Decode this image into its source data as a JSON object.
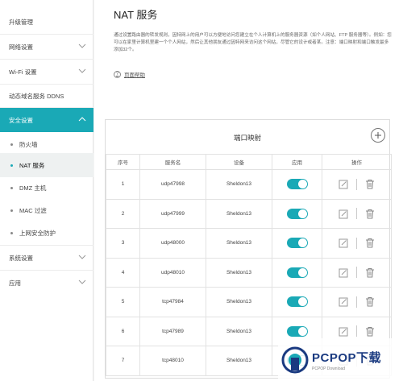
{
  "sidebar": {
    "items": [
      {
        "label": "升级管理"
      },
      {
        "label": "网络设置"
      },
      {
        "label": "Wi-Fi 设置"
      },
      {
        "label": "动态域名服务 DDNS"
      },
      {
        "label": "安全设置"
      },
      {
        "label": "防火墙"
      },
      {
        "label": "NAT 服务"
      },
      {
        "label": "DMZ 主机"
      },
      {
        "label": "MAC 过滤"
      },
      {
        "label": "上网安全防护"
      },
      {
        "label": "系统设置"
      },
      {
        "label": "应用"
      }
    ]
  },
  "main": {
    "title": "NAT 服务",
    "description": "通过设置路由器的转发规则，因特网上的用户可以方便地访问您建立在个人计算机上的服务器资源（如个人网站、FTP 服务器等）。例如：您可以在家里计算机里建一个个人网站，然后让其他朋友通过因特网来访问这个网站，尽管它的设计或者某。注意：端口映射和端口触发最多添加32个。",
    "help_label": "页面帮助",
    "panel": {
      "title": "端口映射",
      "columns": [
        "序号",
        "服务名",
        "设备",
        "应用",
        "操作"
      ],
      "rows": [
        {
          "index": "1",
          "service": "udp47998",
          "device": "Sheldon13",
          "enabled": true
        },
        {
          "index": "2",
          "service": "udp47999",
          "device": "Sheldon13",
          "enabled": true
        },
        {
          "index": "3",
          "service": "udp48000",
          "device": "Sheldon13",
          "enabled": true
        },
        {
          "index": "4",
          "service": "udp48010",
          "device": "Sheldon13",
          "enabled": true
        },
        {
          "index": "5",
          "service": "tcp47984",
          "device": "Sheldon13",
          "enabled": true
        },
        {
          "index": "6",
          "service": "tcp47989",
          "device": "Sheldon13",
          "enabled": true
        },
        {
          "index": "7",
          "service": "tcp48010",
          "device": "Sheldon13",
          "enabled": true
        }
      ]
    }
  },
  "watermark": {
    "main": "PCPOP下载",
    "sub": "PCPOP Download"
  },
  "colors": {
    "accent": "#1aa9b6",
    "brand": "#1a3a80"
  }
}
